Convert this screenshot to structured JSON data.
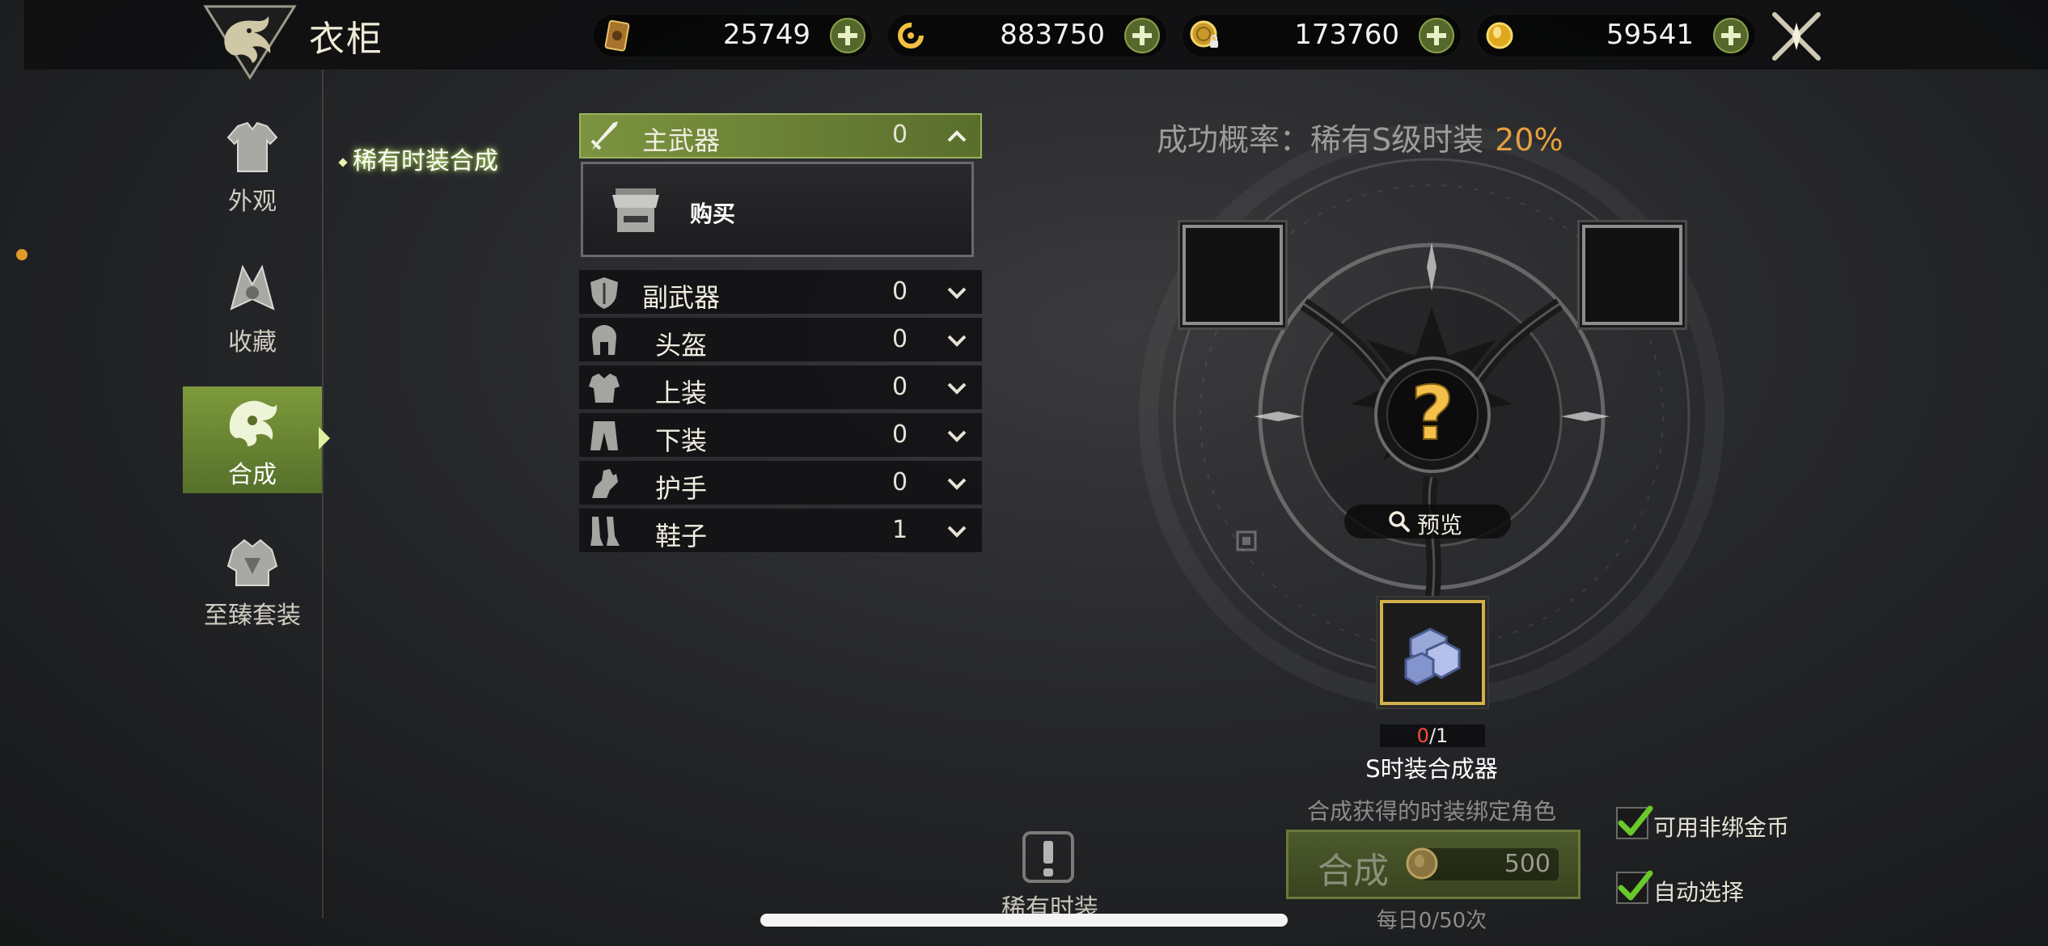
{
  "header": {
    "title": "衣柜"
  },
  "currencies": [
    {
      "icon": "card-currency-icon",
      "value": "25749",
      "add_label": "+"
    },
    {
      "icon": "spiral-currency-icon",
      "value": "883750",
      "add_label": "+"
    },
    {
      "icon": "bound-gold-coin-icon",
      "value": "173760",
      "add_label": "+"
    },
    {
      "icon": "gold-coin-icon",
      "value": "59541",
      "add_label": "+"
    }
  ],
  "nav": {
    "items": [
      {
        "label": "外观",
        "icon": "appearance-icon"
      },
      {
        "label": "收藏",
        "icon": "collection-icon"
      },
      {
        "label": "合成",
        "icon": "synthesis-icon",
        "active": true
      },
      {
        "label": "至臻套装",
        "icon": "premium-set-icon"
      }
    ],
    "sub_tab": "稀有时装合成"
  },
  "categories": [
    {
      "label": "主武器",
      "count": "0",
      "expanded": true,
      "icon": "sword-icon"
    },
    {
      "label": "副武器",
      "count": "0",
      "expanded": false,
      "icon": "shield-icon"
    },
    {
      "label": "头盔",
      "count": "0",
      "expanded": false,
      "icon": "helmet-icon"
    },
    {
      "label": "上装",
      "count": "0",
      "expanded": false,
      "icon": "chest-armor-icon"
    },
    {
      "label": "下装",
      "count": "0",
      "expanded": false,
      "icon": "pants-icon"
    },
    {
      "label": "护手",
      "count": "0",
      "expanded": false,
      "icon": "gloves-icon"
    },
    {
      "label": "鞋子",
      "count": "1",
      "expanded": false,
      "icon": "boots-icon"
    }
  ],
  "buy_card": {
    "label": "购买"
  },
  "synthesis": {
    "rate_label": "成功概率：稀有S级时装",
    "rate_value": "20%",
    "result_symbol": "?",
    "preview_label": "预览",
    "material": {
      "current": "0",
      "required": "/1",
      "name": "S时装合成器"
    },
    "bind_note": "合成获得的时装绑定角色",
    "craft_label": "合成",
    "craft_cost": "500",
    "daily_limit": "每日0/50次"
  },
  "options": [
    {
      "label": "可用非绑金币",
      "checked": true
    },
    {
      "label": "自动选择",
      "checked": true
    }
  ],
  "notice": {
    "label": "稀有时装"
  },
  "colors": {
    "accent_green": "#7d9a3c",
    "rate_orange": "#e6a03a",
    "material_frame": "#d2b04a"
  }
}
